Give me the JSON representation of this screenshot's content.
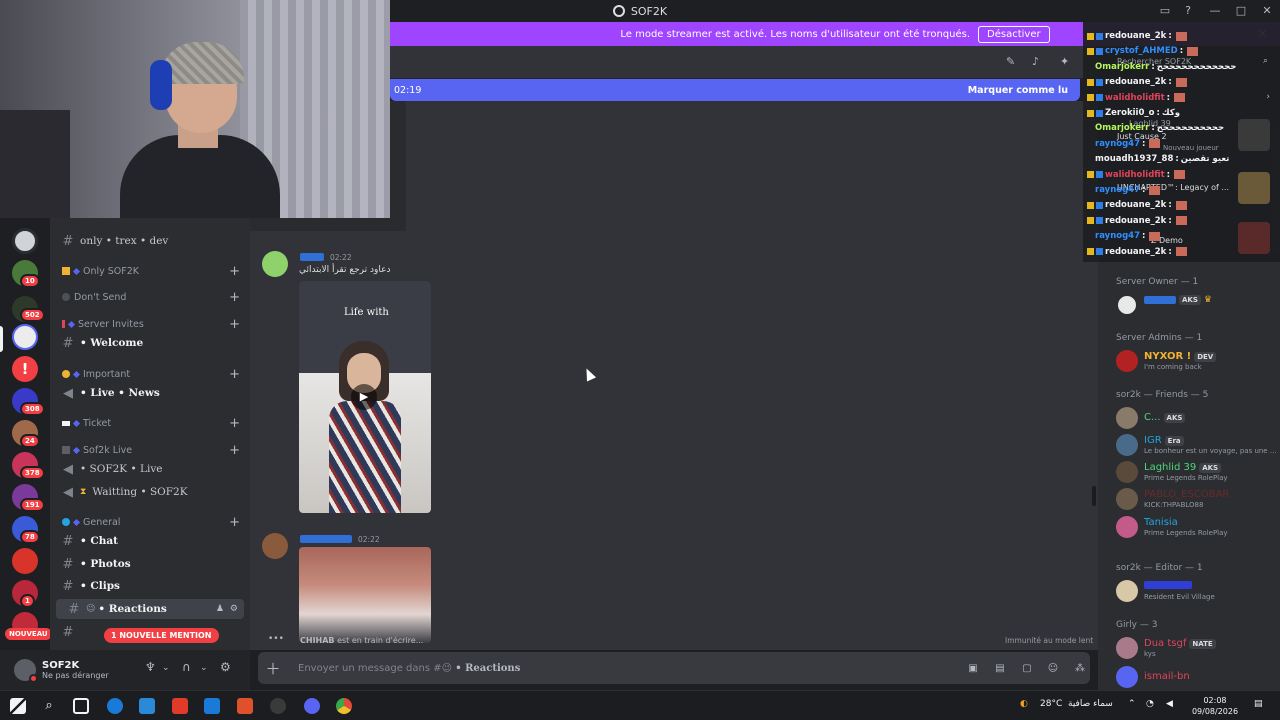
{
  "window": {
    "title": "SOF2K"
  },
  "banner": {
    "text": "Le mode streamer est activé. Les noms d'utilisateur ont été tronqués.",
    "button": "Désactiver"
  },
  "newbar": {
    "time": "02:19",
    "action": "Marquer comme lu"
  },
  "server_badges": [
    "10",
    "502",
    "308",
    "24",
    "378",
    "191",
    "78",
    "1"
  ],
  "nouveau": "NOUVEAU",
  "channels": {
    "top_channel": "only • trex • dev",
    "cat_only": "Only SOF2K",
    "cat_dont": "Don't Send",
    "cat_invites": "Server Invites",
    "welcome": "• Welcome",
    "cat_important": "Important",
    "live_news": "• Live • News",
    "cat_ticket": "Ticket",
    "cat_sof2klive": "Sof2k Live",
    "sof2k_live": "• SOF2K • Live",
    "waitting": "Waitting • SOF2K",
    "cat_general": "General",
    "chat": "• Chat",
    "photos": "• Photos",
    "clips": "• Clips",
    "reactions": "• Reactions",
    "mention": "1 NOUVELLE MENTION"
  },
  "user": {
    "name": "SOF2K",
    "status": "Ne pas déranger"
  },
  "messages": [
    {
      "time": "02:22",
      "text": "دعاود ترجع تقرأ الابتدائي",
      "video_caption": "Life with"
    },
    {
      "time": "02:22"
    }
  ],
  "typing": {
    "who": "CHIHAB",
    "rest": "est en train d'écrire..."
  },
  "slowmode": "Immunité au mode lent",
  "composer": {
    "placeholder": "Envoyer un message dans #",
    "channel": "• Reactions"
  },
  "twitch_chat": [
    {
      "user": "redouane_2k",
      "color": "#f2f3f5",
      "msg": "",
      "badge": true
    },
    {
      "user": "crystof_AHMED",
      "color": "#2f8fff",
      "msg": "",
      "badge": true
    },
    {
      "user": "Omarjokerr",
      "color": "#b5f75a",
      "msg": "ححححححححححححح",
      "badge": false
    },
    {
      "user": "redouane_2k",
      "color": "#f2f3f5",
      "msg": "",
      "badge": true
    },
    {
      "user": "walidholidfit",
      "color": "#e0445a",
      "msg": "",
      "badge": true
    },
    {
      "user": "Zerokii0_o",
      "color": "#f2f3f5",
      "msg": "وكك",
      "badge": true
    },
    {
      "user": "Omarjokerr",
      "color": "#b5f75a",
      "msg": "ححححححححححح",
      "badge": false
    },
    {
      "user": "raynog47",
      "color": "#2f8fff",
      "msg": "",
      "badge": false
    },
    {
      "user": "mouadh1937_88",
      "color": "#f2f3f5",
      "msg": "تعيو تقصين",
      "badge": false
    },
    {
      "user": "walidholidfit",
      "color": "#e0445a",
      "msg": "",
      "badge": true
    },
    {
      "user": "raynog47",
      "color": "#2f8fff",
      "msg": "",
      "badge": false
    },
    {
      "user": "redouane_2k",
      "color": "#f2f3f5",
      "msg": "",
      "badge": true
    },
    {
      "user": "redouane_2k",
      "color": "#f2f3f5",
      "msg": "",
      "badge": true
    },
    {
      "user": "raynog47",
      "color": "#2f8fff",
      "msg": "",
      "badge": false
    },
    {
      "user": "redouane_2k",
      "color": "#f2f3f5",
      "msg": "",
      "badge": true
    }
  ],
  "overlay_texts": {
    "search": "Rechercher SOF2K",
    "game1": "Just Cause 2",
    "game2": "UNCHARTED™: Legacy of ...",
    "game3": "Z Demo",
    "new_player": "Nouveau joueur",
    "laghlid": "Laghlid 39"
  },
  "members": {
    "g_owner": "Server Owner — 1",
    "owner_tag": "AKS",
    "g_admins": "Server Admins — 1",
    "nyxor": "NYXOR !",
    "nyxor_tag": "DEV",
    "nyxor_sub": "I'm coming back",
    "g_friends": "sor2k — Friends — 5",
    "c_name": "C...",
    "c_tag": "AKS",
    "igr": "IGR",
    "igr_tag": "Era",
    "igr_sub": "Le bonheur est un voyage, pas une ...",
    "laghlid": "Laghlid 39",
    "laghlid_tag": "AKS",
    "laghlid_sub": "Prime Legends RolePlay",
    "pablo": "PABLO_ESCOBAR",
    "pablo_sub": "KICK:THPABLO88",
    "tanisia": "Tanisia",
    "tanisia_sub": "Prime Legends RolePlay",
    "g_editor": "sor2k — Editor — 1",
    "editor_sub": "Resident Evil Village",
    "g_girly": "Girly — 3",
    "dua": "Dua tsgf",
    "dua_tag": "NATE",
    "dua_sub": "kys",
    "ismail": "ismail-bn"
  },
  "taskbar": {
    "weather": "28°C",
    "weather_text": "سماء صافية",
    "time": "02:08",
    "date": "09/08/2026"
  }
}
